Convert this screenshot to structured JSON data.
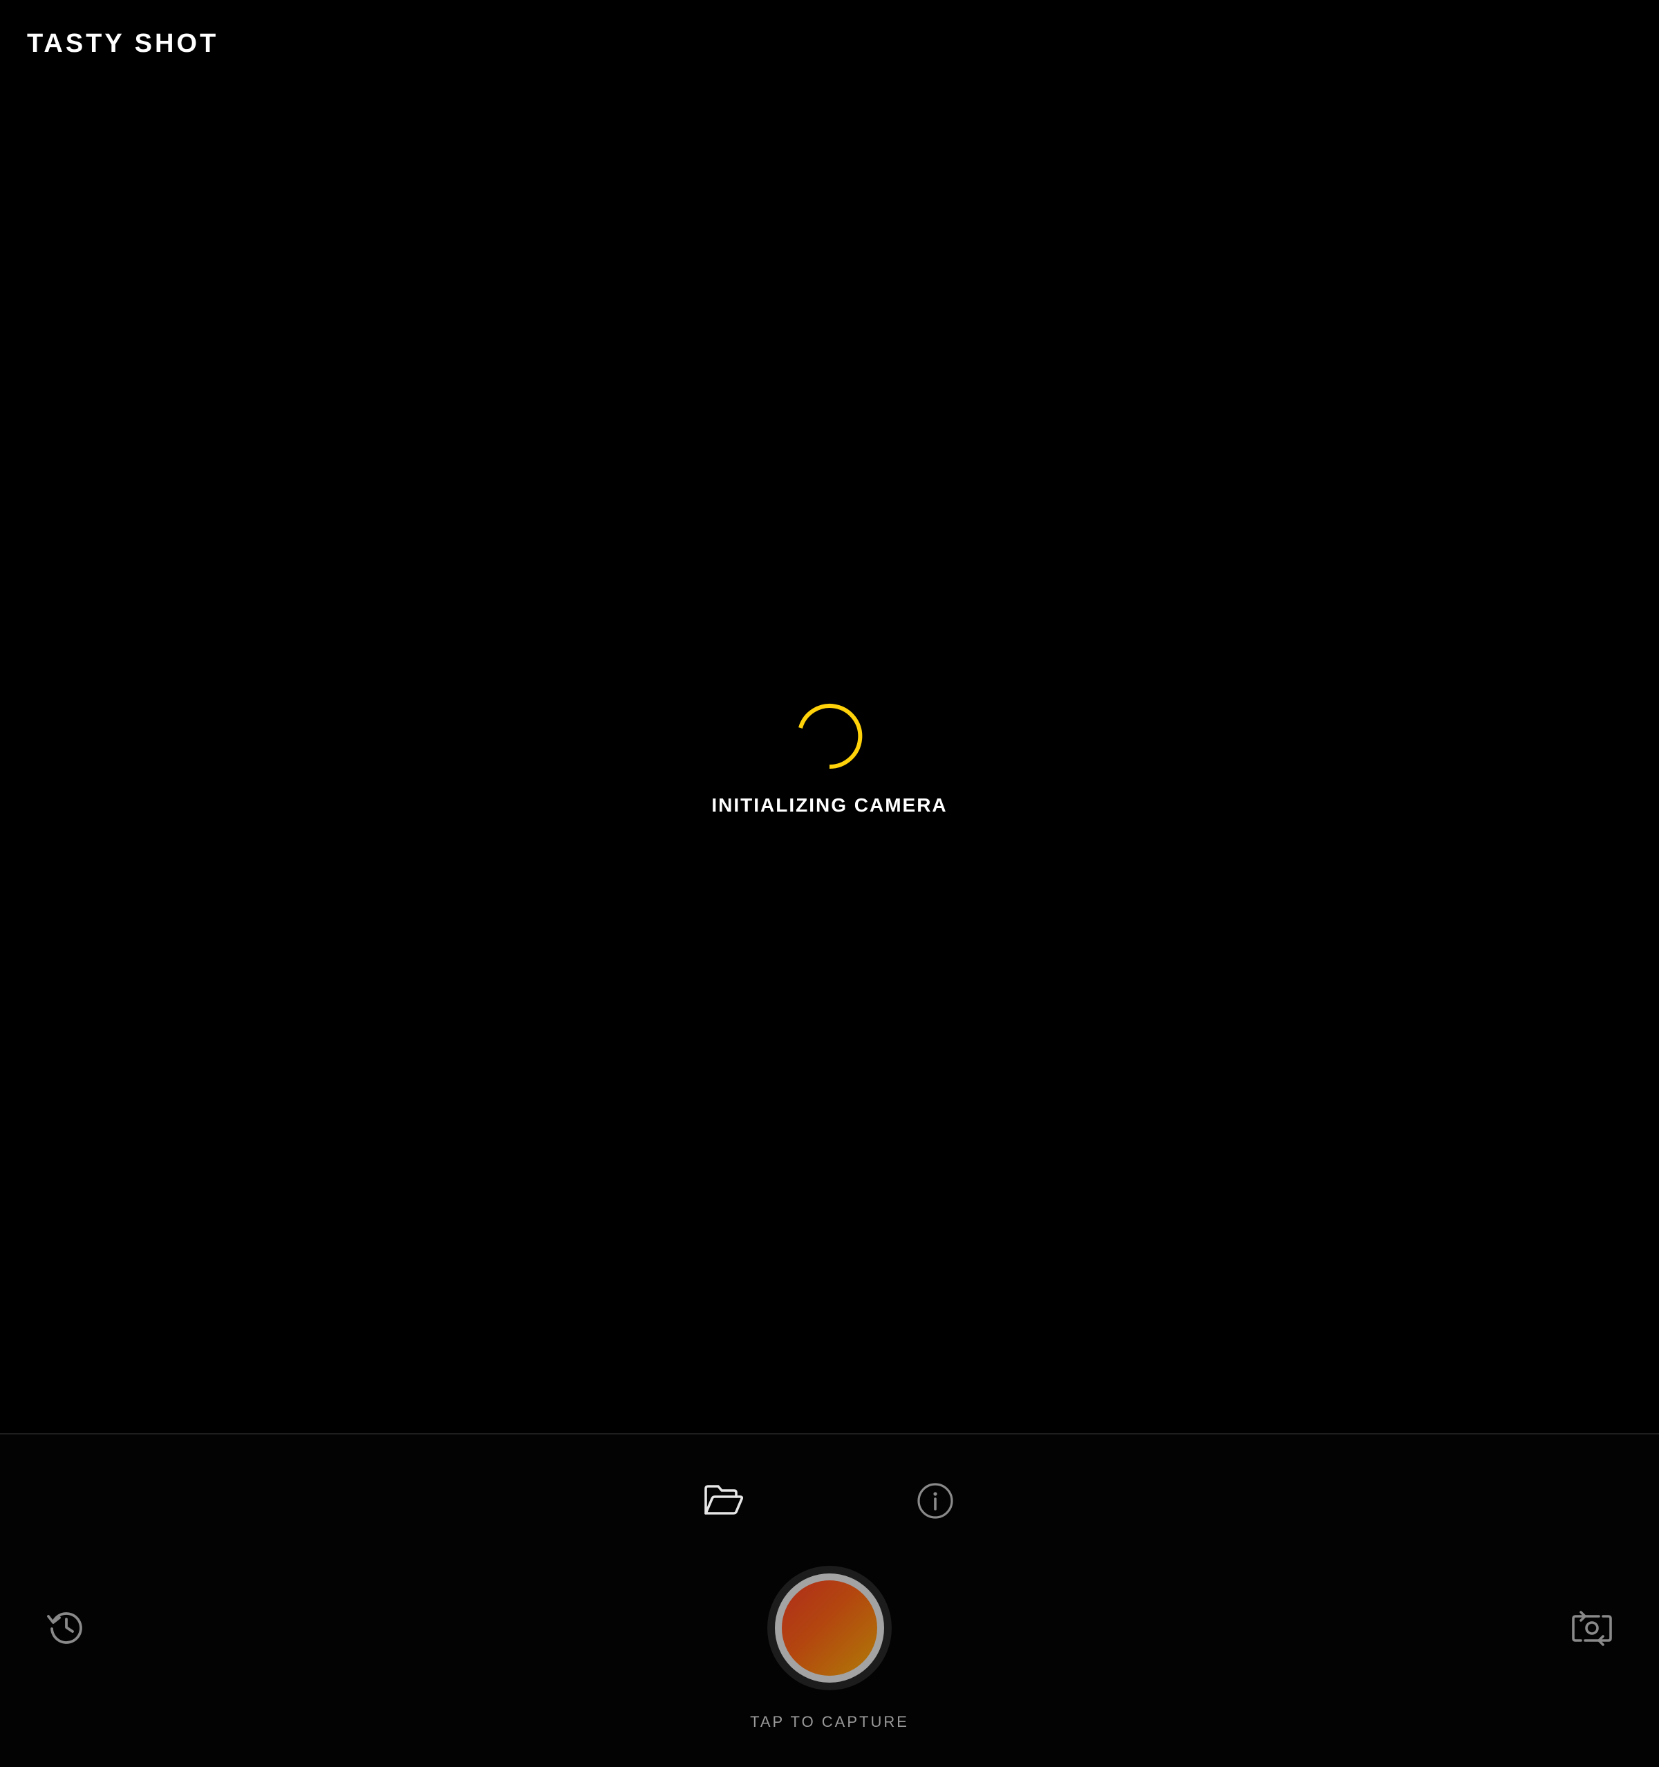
{
  "header": {
    "app_title": "TASTY SHOT"
  },
  "viewfinder": {
    "status_text": "INITIALIZING CAMERA",
    "spinner_color": "#ffd20a"
  },
  "controls": {
    "top_row": [
      {
        "icon": "folder-open-icon"
      },
      {
        "icon": "info-icon"
      }
    ],
    "left_icon": "history-icon",
    "right_icon": "camera-flip-icon",
    "shutter": {
      "label": "TAP TO CAPTURE",
      "gradient_colors": [
        "#b02c1a",
        "#b3470f",
        "#b07b07"
      ]
    }
  }
}
